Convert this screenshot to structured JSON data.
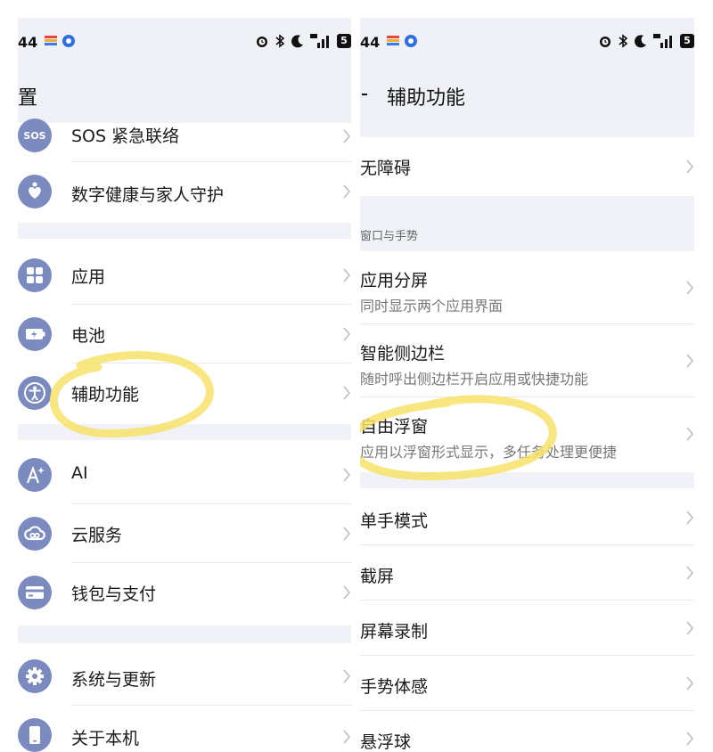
{
  "left": {
    "status": {
      "time": "44",
      "battery": "5"
    },
    "header": {
      "title": "置"
    },
    "group1": [
      {
        "label": "SOS 紧急联络",
        "icon": "sos-icon",
        "icon_text": "SOS"
      },
      {
        "label": "数字健康与家人守护",
        "icon": "heart-hand-icon"
      }
    ],
    "group2": [
      {
        "label": "应用",
        "icon": "apps-grid-icon"
      },
      {
        "label": "电池",
        "icon": "battery-icon"
      },
      {
        "label": "辅助功能",
        "icon": "accessibility-icon"
      }
    ],
    "group3": [
      {
        "label": "AI",
        "icon": "ai-sparkle-icon"
      },
      {
        "label": "云服务",
        "icon": "cloud-icon"
      },
      {
        "label": "钱包与支付",
        "icon": "wallet-icon"
      }
    ],
    "group4": [
      {
        "label": "系统与更新",
        "icon": "gear-icon"
      },
      {
        "label": "关于本机",
        "icon": "phone-icon"
      }
    ]
  },
  "right": {
    "status": {
      "time": "44",
      "battery": "5"
    },
    "header": {
      "title": "辅助功能"
    },
    "group1": [
      {
        "label": "无障碍"
      }
    ],
    "section_label": "窗口与手势",
    "group2": [
      {
        "label": "应用分屏",
        "sub": "同时显示两个应用界面"
      },
      {
        "label": "智能侧边栏",
        "sub": "随时呼出侧边栏开启应用或快捷功能"
      },
      {
        "label": "自由浮窗",
        "sub": "应用以浮窗形式显示，多任务处理更便捷"
      }
    ],
    "group3": [
      {
        "label": "单手模式"
      },
      {
        "label": "截屏"
      },
      {
        "label": "屏幕录制"
      },
      {
        "label": "手势体感"
      },
      {
        "label": "悬浮球"
      }
    ]
  },
  "colors": {
    "icon_bg": "#7b8bbf",
    "section_bg": "#f0f2f7",
    "header_bg": "#eff1f6",
    "highlight": "#f7e26a"
  }
}
